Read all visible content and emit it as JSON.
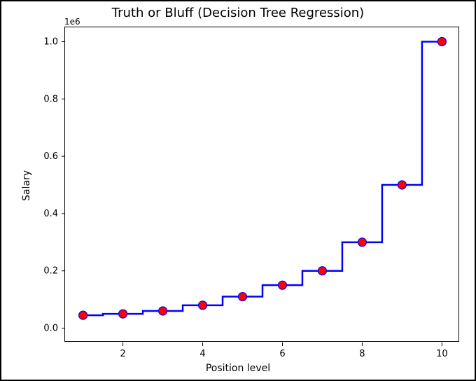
{
  "chart_data": {
    "type": "line",
    "title": "Truth or Bluff (Decision Tree Regression)",
    "xlabel": "Position level",
    "ylabel": "Salary",
    "y_offset_text": "1e6",
    "xlim": [
      0.55,
      10.45
    ],
    "ylim": [
      -50000,
      1050000
    ],
    "x_ticks": [
      2,
      4,
      6,
      8,
      10
    ],
    "y_ticks": [
      0.0,
      0.2,
      0.4,
      0.6,
      0.8,
      1.0
    ],
    "y_tick_scale": 1000000,
    "series": [
      {
        "name": "prediction-step",
        "kind": "step",
        "color": "#0000ff",
        "x": [
          1,
          1.5,
          1.5,
          2.5,
          2.5,
          3.5,
          3.5,
          4.5,
          4.5,
          5.5,
          5.5,
          6.5,
          6.5,
          7.5,
          7.5,
          8.5,
          8.5,
          9.5,
          9.5,
          10
        ],
        "y": [
          45000,
          45000,
          50000,
          50000,
          60000,
          60000,
          80000,
          80000,
          110000,
          110000,
          150000,
          150000,
          200000,
          200000,
          300000,
          300000,
          500000,
          500000,
          1000000,
          1000000
        ]
      },
      {
        "name": "data-points",
        "kind": "scatter",
        "color": "#ff0000",
        "x": [
          1,
          2,
          3,
          4,
          5,
          6,
          7,
          8,
          9,
          10
        ],
        "y": [
          45000,
          50000,
          60000,
          80000,
          110000,
          150000,
          200000,
          300000,
          500000,
          1000000
        ]
      }
    ]
  },
  "layout": {
    "axes_left": 90,
    "axes_top": 36,
    "axes_width": 564,
    "axes_height": 450
  }
}
